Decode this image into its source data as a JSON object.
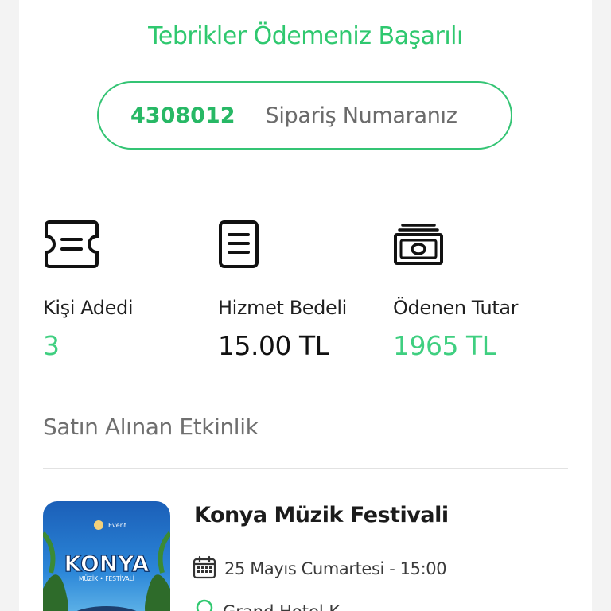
{
  "success": {
    "title": "Tebrikler Ödemeniz Başarılı"
  },
  "order": {
    "number": "4308012",
    "label": "Sipariş Numaranız"
  },
  "stats": [
    {
      "label": "Kişi Adedi",
      "value": "3",
      "icon": "ticket-icon"
    },
    {
      "label": "Hizmet Bedeli",
      "value": "15.00 TL",
      "icon": "document-icon"
    },
    {
      "label": "Ödenen Tutar",
      "value": "1965 TL",
      "icon": "money-icon"
    }
  ],
  "purchased": {
    "section_title": "Satın Alınan Etkinlik",
    "event": {
      "name": "Konya Müzik Festivali",
      "date": "25 Mayıs Cumartesi - 15:00",
      "location": "Grand Hotel K...",
      "poster_title": "KONYA",
      "poster_subtitle": "MÜZİK • FESTİVALİ",
      "poster_brand": "Event"
    }
  },
  "colors": {
    "accent": "#2fc86f",
    "text": "#1f1f1f",
    "muted": "#6f6f6f"
  }
}
